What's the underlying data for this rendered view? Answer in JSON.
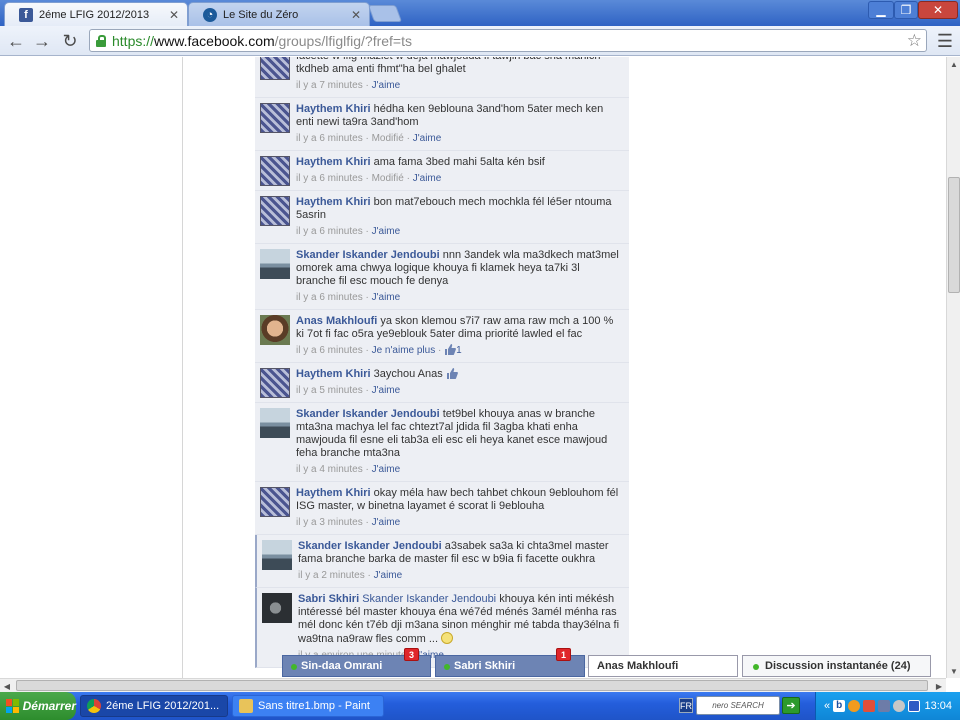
{
  "browser": {
    "tabs": [
      {
        "title": "2éme LFIG 2012/2013",
        "favicon": "facebook-favicon",
        "active": true
      },
      {
        "title": "Le Site du Zéro",
        "favicon": "zero-favicon",
        "active": false
      }
    ],
    "url": {
      "scheme": "https://",
      "host": "www.facebook.com",
      "path": "/groups/lfiglfig/?fref=ts"
    }
  },
  "feed": {
    "comments": [
      {
        "author": "",
        "text": "facette w lfig mazlet w deja mawjouda fi tawjih bac sna mahich tkdheb ama enti fhmt\"ha bel ghalet",
        "time": "il y a 7 minutes",
        "edited": "",
        "like": "J'aime",
        "likes": "",
        "avatar": "grid"
      },
      {
        "author": "Haythem Khiri",
        "text": "hédha ken 9eblouna 3and'hom 5ater mech ken enti newi ta9ra 3and'hom",
        "time": "il y a 6 minutes",
        "edited": "Modifié",
        "like": "J'aime",
        "likes": "",
        "avatar": "grid"
      },
      {
        "author": "Haythem Khiri",
        "text": "ama fama 3bed mahi 5alta kén bsif",
        "time": "il y a 6 minutes",
        "edited": "Modifié",
        "like": "J'aime",
        "likes": "",
        "avatar": "grid"
      },
      {
        "author": "Haythem Khiri",
        "text": "bon mat7ebouch mech mochkla fél lé5er ntouma 5asrin",
        "time": "il y a 6 minutes",
        "edited": "",
        "like": "J'aime",
        "likes": "",
        "avatar": "grid"
      },
      {
        "author": "Skander Iskander Jendoubi",
        "text": "nnn 3andek wla ma3dkech mat3mel omorek ama chwya logique khouya fi klamek heya ta7ki 3l branche fil esc mouch fe denya",
        "time": "il y a 6 minutes",
        "edited": "",
        "like": "J'aime",
        "likes": "",
        "avatar": "lake"
      },
      {
        "author": "Anas Makhloufi",
        "text": "ya skon klemou s7i7 raw ama raw mch a 100 % ki 7ot fi fac o5ra ye9eblouk 5ater dima priorité lawled el fac",
        "time": "il y a 6 minutes",
        "edited": "",
        "like": "Je n'aime plus",
        "likes": "1",
        "avatar": "face"
      },
      {
        "author": "Haythem Khiri",
        "text": "3aychou Anas",
        "time": "il y a 5 minutes",
        "edited": "",
        "like": "J'aime",
        "likes": "",
        "avatar": "grid"
      },
      {
        "author": "Skander Iskander Jendoubi",
        "text": "tet9bel khouya anas w branche mta3na machya lel fac chtezt7al jdida fil 3agba khati enha mawjouda fil esne eli tab3a eli esc eli heya kanet esce mawjoud feha branche mta3na",
        "time": "il y a 4 minutes",
        "edited": "",
        "like": "J'aime",
        "likes": "",
        "avatar": "lake"
      },
      {
        "author": "Haythem Khiri",
        "text": "okay méla haw bech tahbet chkoun 9eblouhom fél ISG master, w binetna layamet é scorat li 9eblouha",
        "time": "il y a 3 minutes",
        "edited": "",
        "like": "J'aime",
        "likes": "",
        "avatar": "grid"
      },
      {
        "author": "Skander Iskander Jendoubi",
        "text": "a3sabek sa3a ki chta3mel master fama branche barka de master fil esc w b9ia fi facette oukhra",
        "time": "il y a 2 minutes",
        "edited": "",
        "like": "J'aime",
        "likes": "",
        "avatar": "lake"
      },
      {
        "author": "Sabri Skhiri",
        "mention": "Skander Iskander Jendoubi",
        "text": "khouya kén inti mékésh intéressé bél master khouya éna wé7éd ménés 3amél ménha ras mél donc kén t7éb dji m3ana sinon ménghir mé tabda thay3élna fi wa9tna na9raw fles comm ...",
        "time": "il y a environ une minute",
        "edited": "",
        "like": "J'aime",
        "likes": "",
        "avatar": "dark"
      }
    ]
  },
  "chat": {
    "tabs": [
      {
        "name": "Sin-daa Omrani",
        "badge": "3"
      },
      {
        "name": "Sabri Skhiri",
        "badge": "1"
      },
      {
        "name": "Anas Makhloufi",
        "badge": ""
      }
    ],
    "instant": {
      "label": "Discussion instantanée (24)"
    }
  },
  "taskbar": {
    "start": "Démarrer",
    "items": [
      {
        "label": "2éme LFIG 2012/201...",
        "active": true
      },
      {
        "label": "Sans titre1.bmp - Paint",
        "active": false
      }
    ],
    "lang": "FR",
    "toolbar_brand": "nero SEARCH",
    "clock": "13:04"
  },
  "colors": {
    "fb_blue": "#3b5998",
    "comment_bg": "#edeff4",
    "chat_blue": "#6d84b4",
    "taskbar_blue": "#245edc"
  }
}
